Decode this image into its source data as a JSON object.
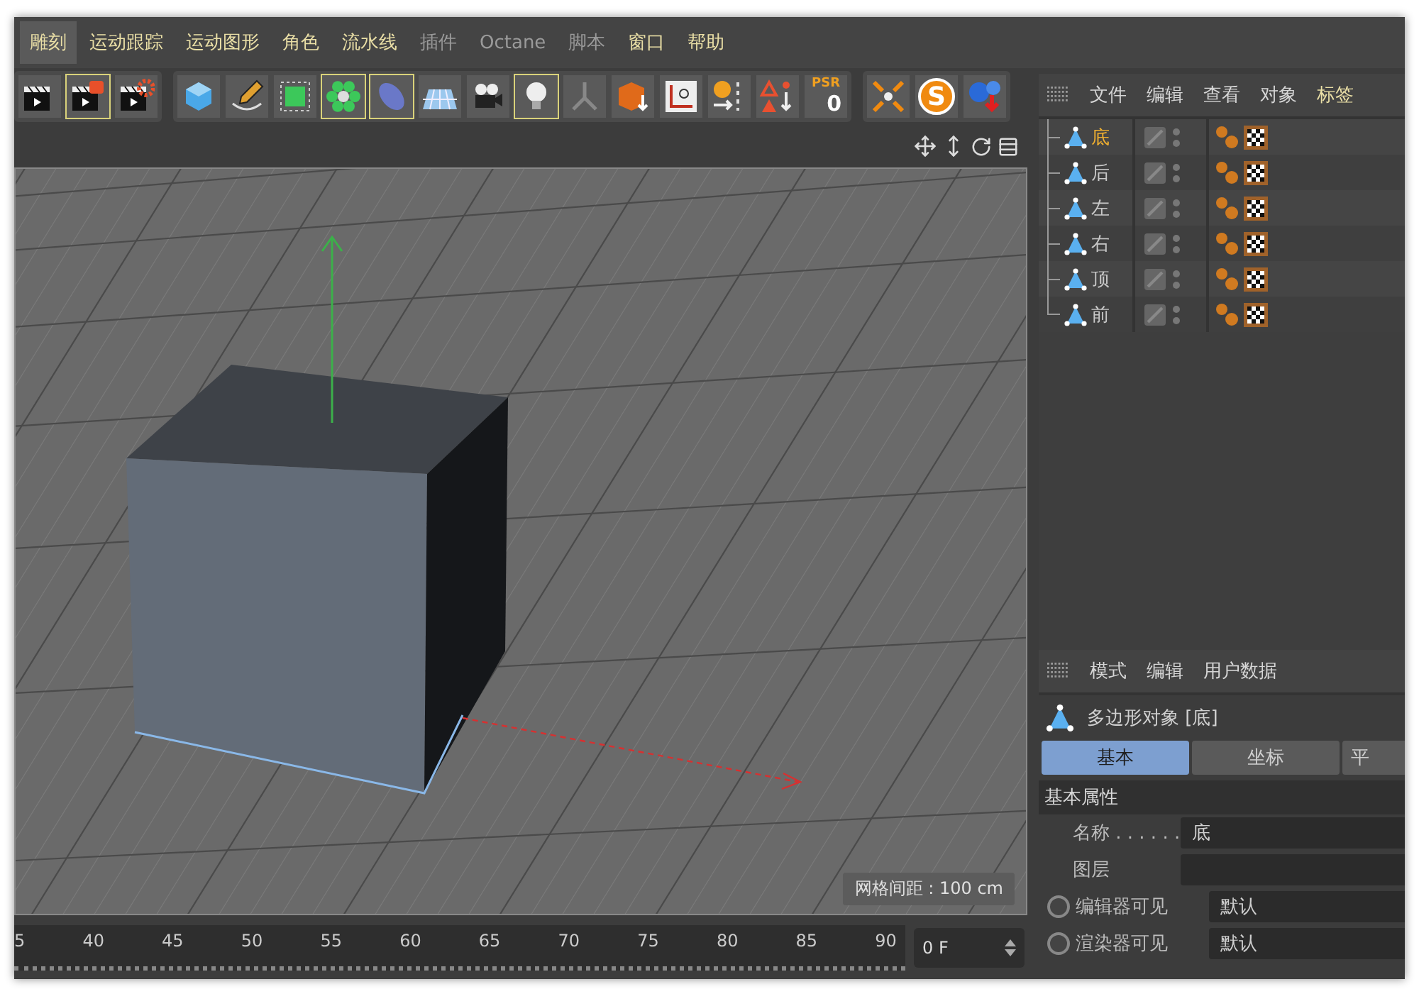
{
  "menu": [
    {
      "label": "雕刻",
      "selected": true,
      "disabled": false
    },
    {
      "label": "运动跟踪",
      "selected": false,
      "disabled": false
    },
    {
      "label": "运动图形",
      "selected": false,
      "disabled": false
    },
    {
      "label": "角色",
      "selected": false,
      "disabled": false
    },
    {
      "label": "流水线",
      "selected": false,
      "disabled": false
    },
    {
      "label": "插件",
      "selected": false,
      "disabled": true
    },
    {
      "label": "Octane",
      "selected": false,
      "disabled": true
    },
    {
      "label": "脚本",
      "selected": false,
      "disabled": true
    },
    {
      "label": "窗口",
      "selected": false,
      "disabled": false
    },
    {
      "label": "帮助",
      "selected": false,
      "disabled": false
    }
  ],
  "toolbar": {
    "groups": [
      [
        {
          "kind": "clapboard",
          "highlighted": false
        },
        {
          "kind": "clapboard-key",
          "highlighted": true
        },
        {
          "kind": "clapboard-gear",
          "highlighted": false
        }
      ],
      [
        {
          "kind": "cube",
          "highlighted": false
        },
        {
          "kind": "pen",
          "highlighted": false
        },
        {
          "kind": "green-cube",
          "highlighted": false
        },
        {
          "kind": "flower",
          "highlighted": true
        },
        {
          "kind": "ellipse",
          "highlighted": true
        },
        {
          "kind": "floor",
          "highlighted": false
        },
        {
          "kind": "camera",
          "highlighted": false
        },
        {
          "kind": "bulb",
          "highlighted": true
        },
        {
          "kind": "branch",
          "highlighted": false
        },
        {
          "kind": "box-arrow",
          "highlighted": false
        },
        {
          "kind": "axis",
          "highlighted": false
        },
        {
          "kind": "sphere-arrow",
          "highlighted": false
        },
        {
          "kind": "triangles",
          "highlighted": false
        },
        {
          "kind": "psr",
          "label": "PSR",
          "value": "0",
          "highlighted": false
        }
      ],
      [
        {
          "kind": "star-arrows",
          "highlighted": false
        },
        {
          "kind": "s-logo",
          "label": "S",
          "highlighted": false
        },
        {
          "kind": "spheres-arrow",
          "highlighted": false
        }
      ]
    ]
  },
  "viewport": {
    "grid_label": "网格间距 : 100 cm"
  },
  "timeline": {
    "ticks": [
      "5",
      "40",
      "45",
      "50",
      "55",
      "60",
      "65",
      "70",
      "75",
      "80",
      "85",
      "90"
    ],
    "frame": "0 F"
  },
  "object_manager": {
    "menu": [
      {
        "label": "文件",
        "highlighted": false
      },
      {
        "label": "编辑",
        "highlighted": false
      },
      {
        "label": "查看",
        "highlighted": false
      },
      {
        "label": "对象",
        "highlighted": false
      },
      {
        "label": "标签",
        "highlighted": true
      }
    ],
    "objects": [
      {
        "name": "底",
        "selected": true
      },
      {
        "name": "后",
        "selected": false
      },
      {
        "name": "左",
        "selected": false
      },
      {
        "name": "右",
        "selected": false
      },
      {
        "name": "顶",
        "selected": false
      },
      {
        "name": "前",
        "selected": false
      }
    ]
  },
  "attributes": {
    "menu": [
      "模式",
      "编辑",
      "用户数据"
    ],
    "title": "多边形对象 [底]",
    "tabs": [
      {
        "label": "基本",
        "selected": true
      },
      {
        "label": "坐标",
        "selected": false
      },
      {
        "label": "平",
        "selected": false
      }
    ],
    "section": "基本属性",
    "fields": [
      {
        "kind": "text",
        "label": "名称 . . . . . .",
        "value": "底"
      },
      {
        "kind": "text",
        "label": "图层"
      },
      {
        "kind": "radio",
        "label": "编辑器可见",
        "value": "默认",
        "checked": false
      },
      {
        "kind": "radio",
        "label": "渲染器可见",
        "value": "默认",
        "checked": false
      }
    ]
  }
}
